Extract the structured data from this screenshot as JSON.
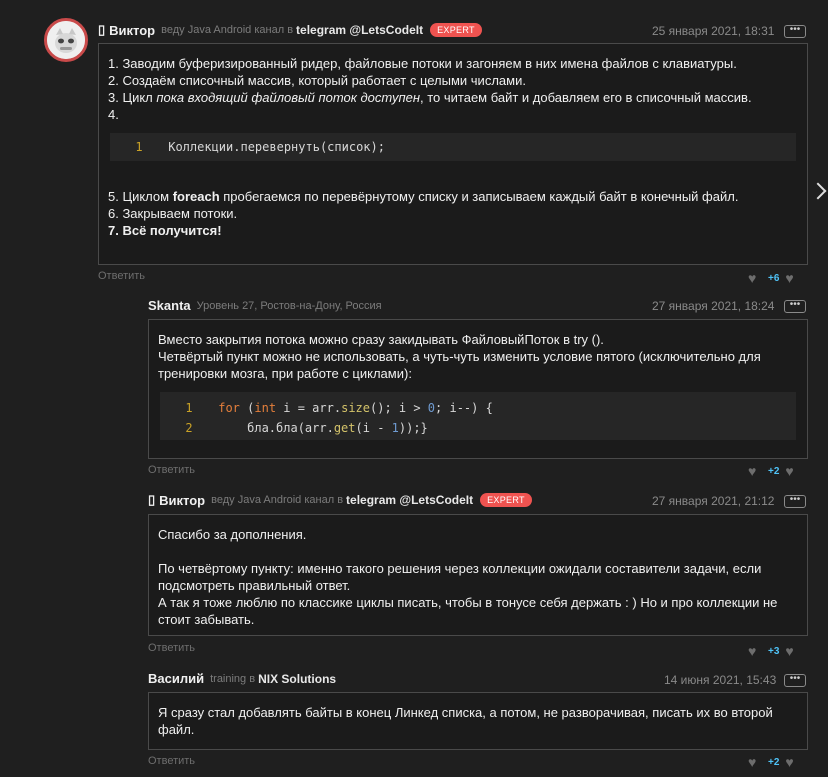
{
  "comments": [
    {
      "author": "Виктор",
      "marker": "▯",
      "meta": "веду Java Android канал в",
      "link": "telegram @LetsCodeIt",
      "badge": "EXPERT",
      "date": "25 января 2021, 18:31",
      "lines": [
        "1. Заводим буферизированный ридер, файловые потоки и загоняем в них имена файлов с клавиатуры.",
        "2. Создаём списочный массив, который работает с целыми числами.",
        "3. Цикл ",
        "пока входящий файловый поток доступен",
        ", то читаем байт и добавляем его в списочный массив.",
        "4.",
        "5. Циклом ",
        "foreach",
        " пробегаемся по перевёрнутому списку и записываем каждый байт в конечный файл.",
        "6. Закрываем потоки.",
        "7. Всё получится!"
      ],
      "code": [
        {
          "n": "1",
          "text": "Коллекции.перевернуть(список);"
        }
      ],
      "reply": "Ответить",
      "score": "+6"
    },
    {
      "author": "Skanta",
      "meta": "Уровень 27, Ростов-на-Дону, Россия",
      "date": "27 января 2021, 18:24",
      "lines": [
        "Вместо закрытия потока можно сразу закидывать ФайловыйПоток в try ().",
        "Четвёртый пункт можно не использовать, а чуть-чуть изменить условие пятого (исключительно для тренировки мозга, при работе с циклами):"
      ],
      "code": [
        {
          "n": "1",
          "tokens": [
            "for",
            " (",
            "int",
            " i = arr.",
            "size",
            "(); i > ",
            "0",
            "; i--) {"
          ]
        },
        {
          "n": "2",
          "tokens": [
            "    бла.бла(arr.",
            "get",
            "(i - ",
            "1",
            "));}"
          ]
        }
      ],
      "reply": "Ответить",
      "score": "+2"
    },
    {
      "author": "Виктор",
      "marker": "▯",
      "meta": "веду Java Android канал в",
      "link": "telegram @LetsCodeIt",
      "badge": "EXPERT",
      "date": "27 января 2021, 21:12",
      "lines": [
        "Спасибо за дополнения.",
        "По четвёртому пункту: именно такого решения через коллекции ожидали составители задачи, если подсмотреть правильный ответ.",
        "А так я тоже люблю по классике циклы писать, чтобы в тонусе себя держать : ) Но и про коллекции не стоит забывать."
      ],
      "reply": "Ответить",
      "score": "+3"
    },
    {
      "author": "Василий",
      "meta": "training в",
      "link": "NIX Solutions",
      "date": "14 июня 2021, 15:43",
      "lines": [
        "Я сразу стал добавлять байты в конец Линкед списка, а потом, не разворачивая, писать их во второй файл."
      ],
      "reply": "Ответить",
      "score": "+2"
    }
  ],
  "icons": {
    "more": "more-dots-icon",
    "like": "heart-icon",
    "dislike": "broken-heart-icon",
    "scroll": "chevron-right-icon"
  }
}
